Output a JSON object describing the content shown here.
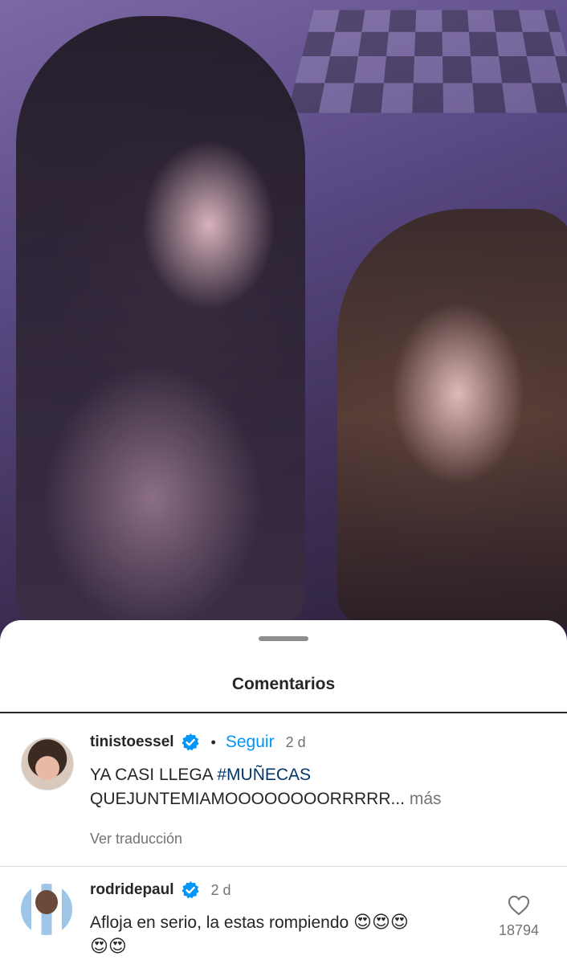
{
  "sheet": {
    "title": "Comentarios"
  },
  "comments": [
    {
      "username": "tinistoessel",
      "follow_label": "Seguir",
      "age": "2 d",
      "text_line1_plain": "YA CASI LLEGA ",
      "hashtag": "#MUÑECAS",
      "text_line2": "QUEJUNTEMIAMOOOOOOOORRRRR",
      "ellipsis": "...",
      "more_label": "más",
      "translate_label": "Ver traducción"
    },
    {
      "username": "rodridepaul",
      "age": "2 d",
      "text": "Afloja en serio, la estas rompiendo",
      "emojis_line1": "😍😍😍",
      "emojis_line2": "😍😍",
      "like_count": "18794"
    }
  ],
  "colors": {
    "accent": "#0095f6",
    "hashtag": "#00376b",
    "muted": "#737373"
  },
  "icons": {
    "verified": "verified-badge-icon",
    "like": "heart-outline-icon"
  }
}
